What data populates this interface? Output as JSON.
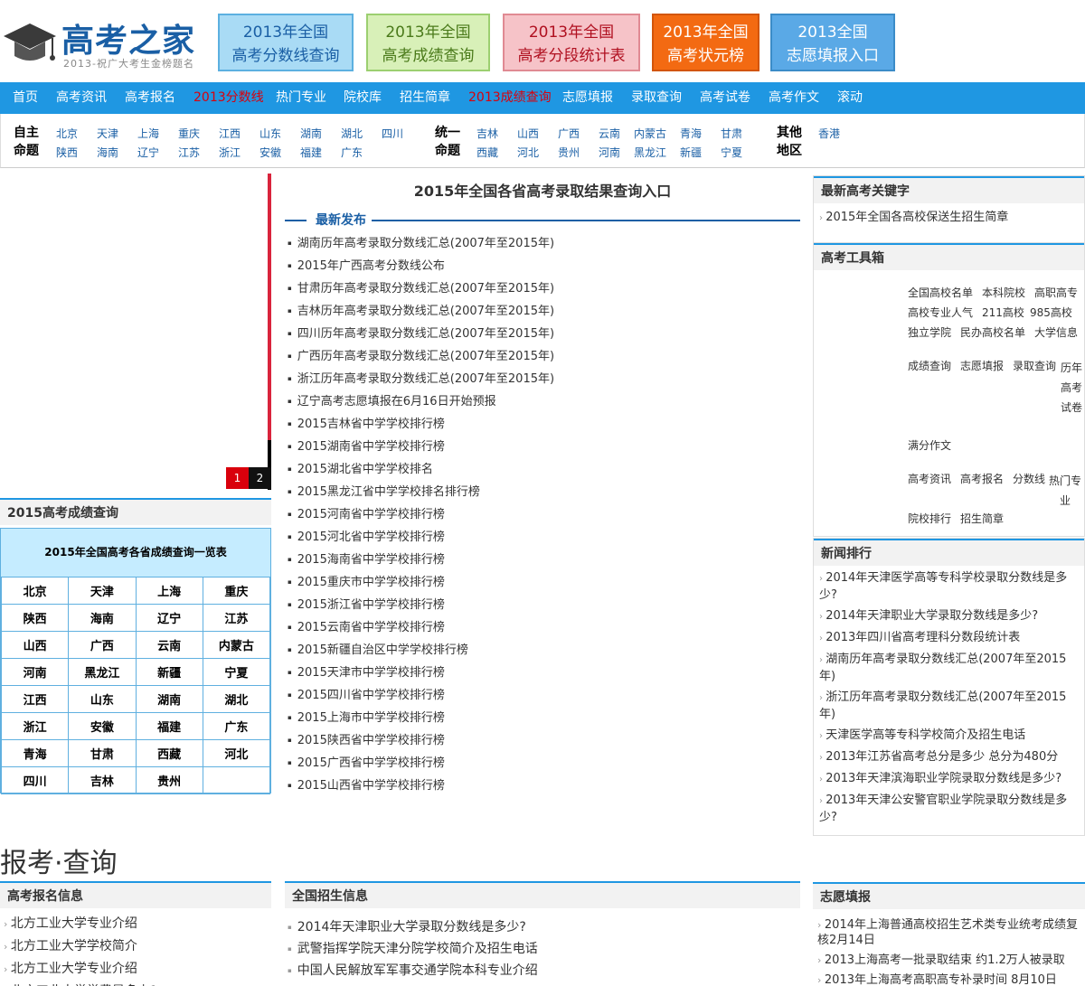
{
  "logo": {
    "title": "高考之家",
    "slogan": "2013-祝广大考生金榜题名"
  },
  "header_buttons": [
    {
      "line1": "2013年全国",
      "line2": "高考分数线查询",
      "bg": "#a9dbf5",
      "border": "#5cb0e0",
      "color": "#1a5fa5"
    },
    {
      "line1": "2013年全国",
      "line2": "高考成绩查询",
      "bg": "#d8f0b8",
      "border": "#9ccf70",
      "color": "#4a7a1a"
    },
    {
      "line1": "2013年全国",
      "line2": "高考分段统计表",
      "bg": "#f6c3c8",
      "border": "#e08a93",
      "color": "#b01020"
    },
    {
      "line1": "2013年全国",
      "line2": "高考状元榜",
      "bg": "#f36a12",
      "border": "#d2550a",
      "color": "#ffffff"
    },
    {
      "line1": "2013全国",
      "line2": "志愿填报入口",
      "bg": "#5aa9e6",
      "border": "#3b8cc8",
      "color": "#ffffff"
    }
  ],
  "nav": [
    {
      "label": "首页",
      "hot": false
    },
    {
      "label": "高考资讯",
      "hot": false
    },
    {
      "label": "高考报名",
      "hot": false
    },
    {
      "label": "2013分数线",
      "hot": true
    },
    {
      "label": "热门专业",
      "hot": false
    },
    {
      "label": "院校库",
      "hot": false
    },
    {
      "label": "招生简章",
      "hot": false
    },
    {
      "label": "2013成绩查询",
      "hot": true
    },
    {
      "label": "志愿填报",
      "hot": false
    },
    {
      "label": "录取查询",
      "hot": false
    },
    {
      "label": "高考试卷",
      "hot": false
    },
    {
      "label": "高考作文",
      "hot": false
    },
    {
      "label": "滚动",
      "hot": false
    }
  ],
  "provinces": {
    "group1": {
      "label1": "自主",
      "label2": "命题",
      "row1": [
        "北京",
        "天津",
        "上海",
        "重庆",
        "江西",
        "山东",
        "湖南",
        "湖北",
        "四川"
      ],
      "row2": [
        "陕西",
        "海南",
        "辽宁",
        "江苏",
        "浙江",
        "安徽",
        "福建",
        "广东"
      ]
    },
    "group2": {
      "label1": "统一",
      "label2": "命题",
      "row1": [
        "吉林",
        "山西",
        "广西",
        "云南",
        "内蒙古",
        "青海",
        "甘肃"
      ],
      "row2": [
        "西藏",
        "河北",
        "贵州",
        "河南",
        "黑龙江",
        "新疆",
        "宁夏"
      ]
    },
    "group3": {
      "label1": "其他",
      "label2": "地区",
      "row1": [
        "香港"
      ]
    }
  },
  "slider": {
    "dots": [
      "1",
      "2"
    ]
  },
  "score_box": {
    "heading": "2015高考成绩查询",
    "subheading": "2015年全国高考各省成绩查询一览表",
    "cells": [
      [
        "北京",
        "天津",
        "上海",
        "重庆"
      ],
      [
        "陕西",
        "海南",
        "辽宁",
        "江苏"
      ],
      [
        "山西",
        "广西",
        "云南",
        "内蒙古"
      ],
      [
        "河南",
        "黑龙江",
        "新疆",
        "宁夏"
      ],
      [
        "江西",
        "山东",
        "湖南",
        "湖北"
      ],
      [
        "浙江",
        "安徽",
        "福建",
        "广东"
      ],
      [
        "青海",
        "甘肃",
        "西藏",
        "河北"
      ],
      [
        "四川",
        "吉林",
        "贵州",
        ""
      ]
    ]
  },
  "center": {
    "title": "2015年全国各省高考录取结果查询入口",
    "section": "最新发布",
    "items": [
      "湖南历年高考录取分数线汇总(2007年至2015年)",
      "2015年广西高考分数线公布",
      "甘肃历年高考录取分数线汇总(2007年至2015年)",
      "吉林历年高考录取分数线汇总(2007年至2015年)",
      "四川历年高考录取分数线汇总(2007年至2015年)",
      "广西历年高考录取分数线汇总(2007年至2015年)",
      "浙江历年高考录取分数线汇总(2007年至2015年)",
      "辽宁高考志愿填报在6月16日开始预报",
      "2015吉林省中学学校排行榜",
      "2015湖南省中学学校排行榜",
      "2015湖北省中学学校排名",
      "2015黑龙江省中学学校排名排行榜",
      "2015河南省中学学校排行榜",
      "2015河北省中学学校排行榜",
      "2015海南省中学学校排行榜",
      "2015重庆市中学学校排行榜",
      "2015浙江省中学学校排行榜",
      "2015云南省中学学校排行榜",
      "2015新疆自治区中学学校排行榜",
      "2015天津市中学学校排行榜",
      "2015四川省中学学校排行榜",
      "2015上海市中学学校排行榜",
      "2015陕西省中学学校排行榜",
      "2015广西省中学学校排行榜",
      "2015山西省中学学校排行榜"
    ]
  },
  "right": {
    "keywords": {
      "heading": "最新高考关键字",
      "items": [
        "2015年全国各高校保送生招生简章"
      ]
    },
    "toolbox": {
      "heading": "高考工具箱",
      "row1": [
        "全国高校名单",
        "本科院校",
        "高职高专"
      ],
      "row2": [
        "高校专业人气",
        "211高校",
        "985高校"
      ],
      "row3": [
        "独立学院",
        "民办高校名单",
        "大学信息"
      ],
      "row4": [
        "成绩查询",
        "志愿填报",
        "录取查询",
        "历年高考试卷"
      ],
      "row5": [
        "满分作文"
      ],
      "row6": [
        "高考资讯",
        "高考报名",
        "分数线",
        "热门专业"
      ],
      "row7": [
        "院校排行",
        "招生简章"
      ]
    },
    "news": {
      "heading": "新闻排行",
      "items": [
        "2014年天津医学高等专科学校录取分数线是多少?",
        "2014年天津职业大学录取分数线是多少?",
        "2013年四川省高考理科分数段统计表",
        "湖南历年高考录取分数线汇总(2007年至2015年)",
        "浙江历年高考录取分数线汇总(2007年至2015年)",
        "天津医学高等专科学校简介及招生电话",
        "2013年江苏省高考总分是多少 总分为480分",
        "2013年天津滨海职业学院录取分数线是多少?",
        "2013年天津公安警官职业学院录取分数线是多少?"
      ]
    }
  },
  "bottom": {
    "title": "报考·查询",
    "col1": {
      "heading": "高考报名信息",
      "items": [
        "北方工业大学专业介绍",
        "北方工业大学学校简介",
        "北方工业大学专业介绍",
        "北方工业大学学费是多少?"
      ]
    },
    "col2": {
      "heading": "全国招生信息",
      "items": [
        "2014年天津职业大学录取分数线是多少?",
        "武警指挥学院天津分院学校简介及招生电话",
        "中国人民解放军军事交通学院本科专业介绍"
      ]
    },
    "col3": {
      "heading": "志愿填报",
      "items": [
        "2014年上海普通高校招生艺术类专业统考成绩复核2月14日",
        "2013上海高考一批录取结束 约1.2万人被录取",
        "2013年上海高考高职高专补录时间 8月10日"
      ]
    }
  }
}
